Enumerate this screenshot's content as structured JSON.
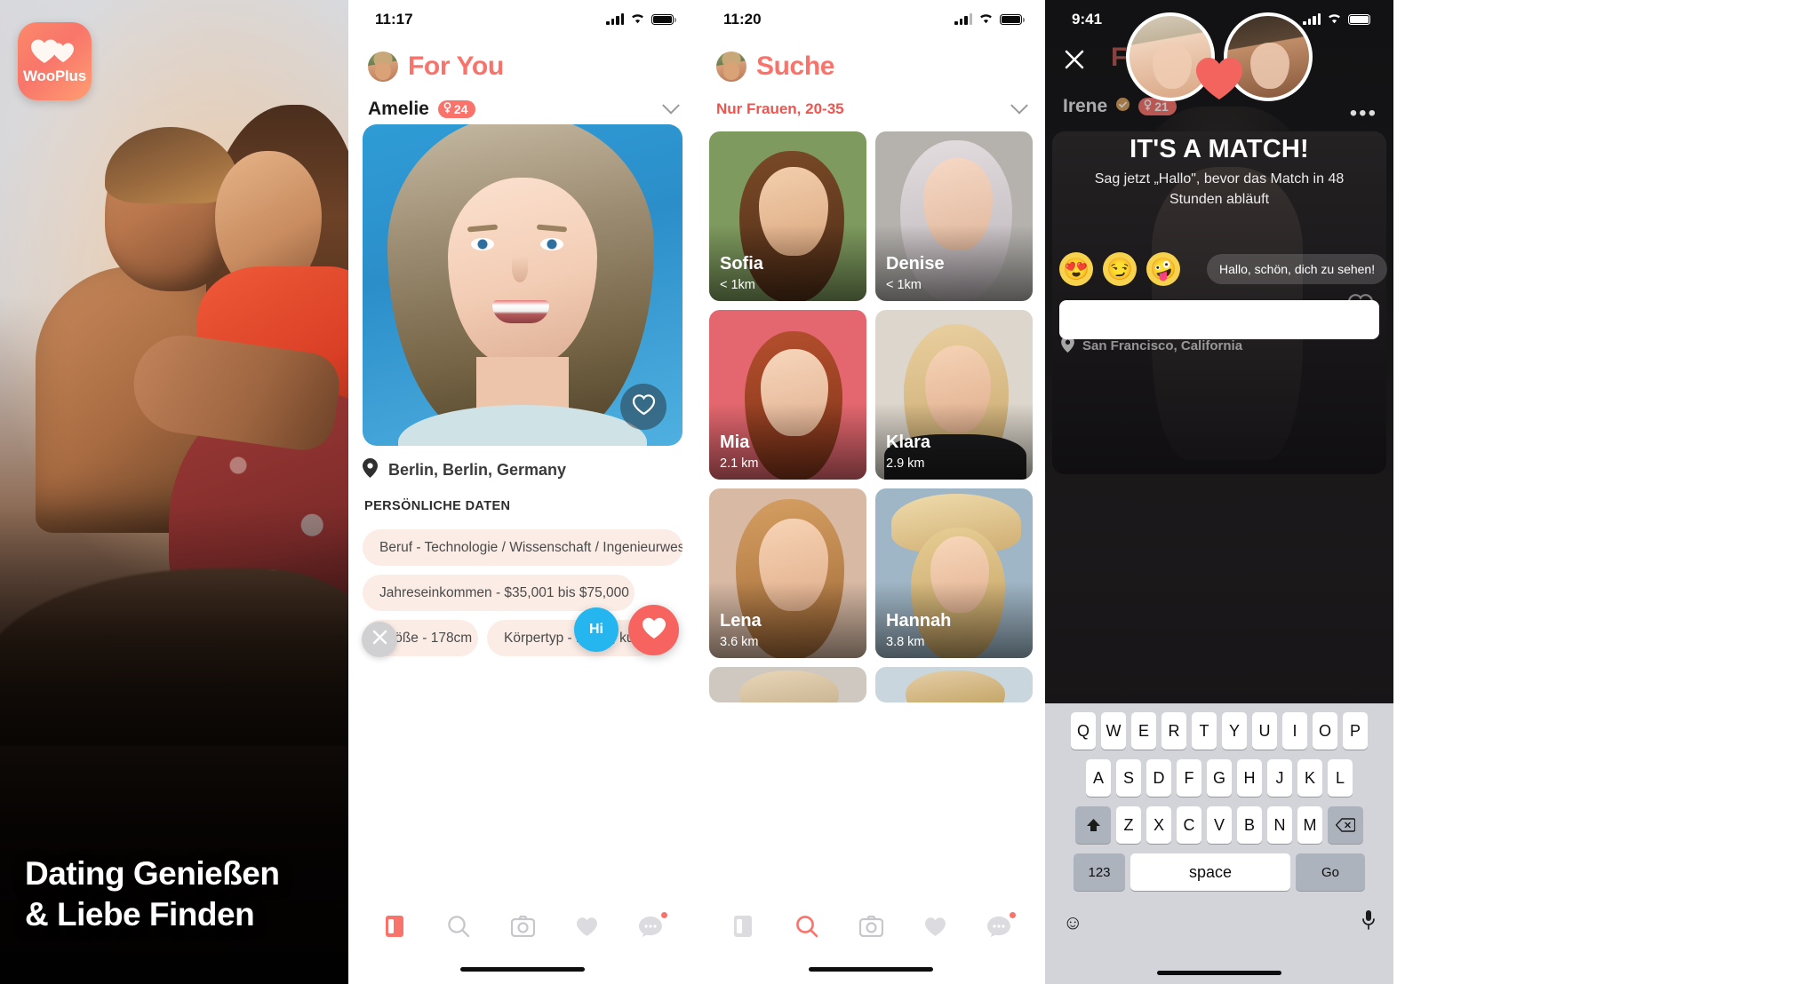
{
  "hero": {
    "logo_text": "WooPlus",
    "logo_icon": "double-heart-icon",
    "tagline_line1": "Dating Genießen",
    "tagline_line2": "& Liebe Finden"
  },
  "foryou": {
    "status_time": "11:17",
    "title": "For You",
    "profile_name": "Amelie",
    "profile_age": "24",
    "gender_icon": "female-icon",
    "location": "Berlin, Berlin, Germany",
    "section_label": "PERSÖNLICHE DATEN",
    "chips": [
      "Beruf - Technologie / Wissenschaft / Ingenieurwesen",
      "Jahreseinkommen - $35,001 bis $75,000",
      "Größe - 178cm",
      "Körpertyp - Mollig, kurvig"
    ],
    "actions": {
      "dislike": "✕",
      "hi": "Hi",
      "like": "heart-icon"
    },
    "tabs": [
      "cards-icon",
      "search-icon",
      "camera-icon",
      "heart-icon",
      "chat-icon"
    ],
    "active_tab": 0
  },
  "suche": {
    "status_time": "11:20",
    "title": "Suche",
    "filter": "Nur Frauen, 20-35",
    "cards": [
      {
        "name": "Sofia",
        "distance": "< 1km",
        "bg": "#7e9a5e",
        "skin": "#e7bb98",
        "hair": "#6b3f22"
      },
      {
        "name": "Denise",
        "distance": "< 1km",
        "bg": "#b5b2ae",
        "skin": "#f0cfbb",
        "hair": "#d9d3d6"
      },
      {
        "name": "Mia",
        "distance": "2.1 km",
        "bg": "#e4676f",
        "skin": "#f3cdb2",
        "hair": "#a8482c"
      },
      {
        "name": "Klara",
        "distance": "2.9 km",
        "bg": "#dcd6cc",
        "skin": "#f2cdb0",
        "hair": "#e0c88f"
      },
      {
        "name": "Lena",
        "distance": "3.6 km",
        "bg": "#d8b9a4",
        "skin": "#eec2a6",
        "hair": "#c08a52"
      },
      {
        "name": "Hannah",
        "distance": "3.8 km",
        "bg": "#9fb6c6",
        "skin": "#f1cdb3",
        "hair": "#ddc390"
      }
    ],
    "partial_cards": [
      {
        "bg": "#cfc8c0"
      },
      {
        "bg": "#c9d6dd"
      }
    ],
    "tabs": [
      "cards-icon",
      "search-icon",
      "camera-icon",
      "heart-icon",
      "chat-icon"
    ],
    "active_tab": 1
  },
  "match": {
    "status_time": "9:41",
    "close_icon": "close-icon",
    "bg_title": "For You",
    "bg_name": "Irene",
    "bg_age": "21",
    "bg_verified_icon": "verified-icon",
    "more_icon": "more-horizontal-icon",
    "heading": "IT'S A MATCH!",
    "subheading": "Sag jetzt „Hallo\", bevor das Match in 48 Stunden abläuft",
    "emojis": [
      "😍",
      "😏",
      "🤪"
    ],
    "quick_reply": "Hallo, schön, dich zu sehen!",
    "input_value": "",
    "bg_location": "San Francisco, California",
    "keyboard": {
      "row1": [
        "Q",
        "W",
        "E",
        "R",
        "T",
        "Y",
        "U",
        "I",
        "O",
        "P"
      ],
      "row2": [
        "A",
        "S",
        "D",
        "F",
        "G",
        "H",
        "J",
        "K",
        "L"
      ],
      "row3": [
        "Z",
        "X",
        "C",
        "V",
        "B",
        "N",
        "M"
      ],
      "shift_icon": "shift-icon",
      "backspace_icon": "backspace-icon",
      "numbers_key": "123",
      "space_key": "space",
      "go_key": "Go",
      "emoji_icon": "emoji-icon",
      "mic_icon": "microphone-icon"
    }
  },
  "colors": {
    "accent": "#f9736b",
    "accent_dark": "#f0544d",
    "chip_bg": "#fcece6",
    "blue": "#25b6f0"
  }
}
